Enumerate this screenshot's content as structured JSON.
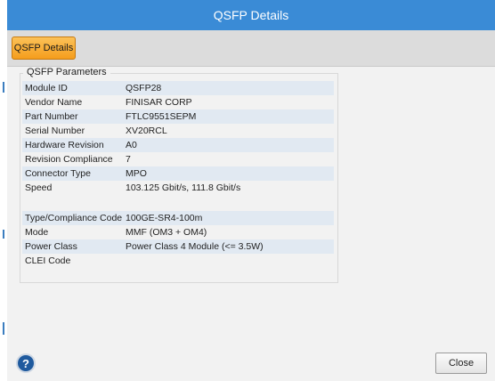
{
  "window": {
    "title": "QSFP Details"
  },
  "toolbar": {
    "tab_label": "QSFP Details"
  },
  "group": {
    "label": "QSFP Parameters"
  },
  "parameters": [
    {
      "key": "Module ID",
      "value": "QSFP28"
    },
    {
      "key": "Vendor Name",
      "value": "FINISAR CORP"
    },
    {
      "key": "Part Number",
      "value": "FTLC9551SEPM"
    },
    {
      "key": "Serial Number",
      "value": "XV20RCL"
    },
    {
      "key": "Hardware Revision",
      "value": "A0"
    },
    {
      "key": "Revision Compliance",
      "value": "7"
    },
    {
      "key": "Connector Type",
      "value": "MPO"
    },
    {
      "key": "Speed",
      "value": "103.125 Gbit/s, 111.8 Gbit/s"
    },
    {
      "key": "",
      "value": ""
    },
    {
      "key": "Type/Compliance Code",
      "value": "100GE-SR4-100m"
    },
    {
      "key": "Mode",
      "value": "MMF (OM3 + OM4)"
    },
    {
      "key": "Power Class",
      "value": "Power Class 4 Module (<= 3.5W)"
    },
    {
      "key": "CLEI Code",
      "value": ""
    }
  ],
  "footer": {
    "help_label": "?",
    "close_label": "Close"
  },
  "icons": {
    "help": "help-icon"
  },
  "colors": {
    "title_bar": "#3a8bd6",
    "active_tab": "#f7a52a",
    "row_stripe": "#e1e9f2"
  }
}
